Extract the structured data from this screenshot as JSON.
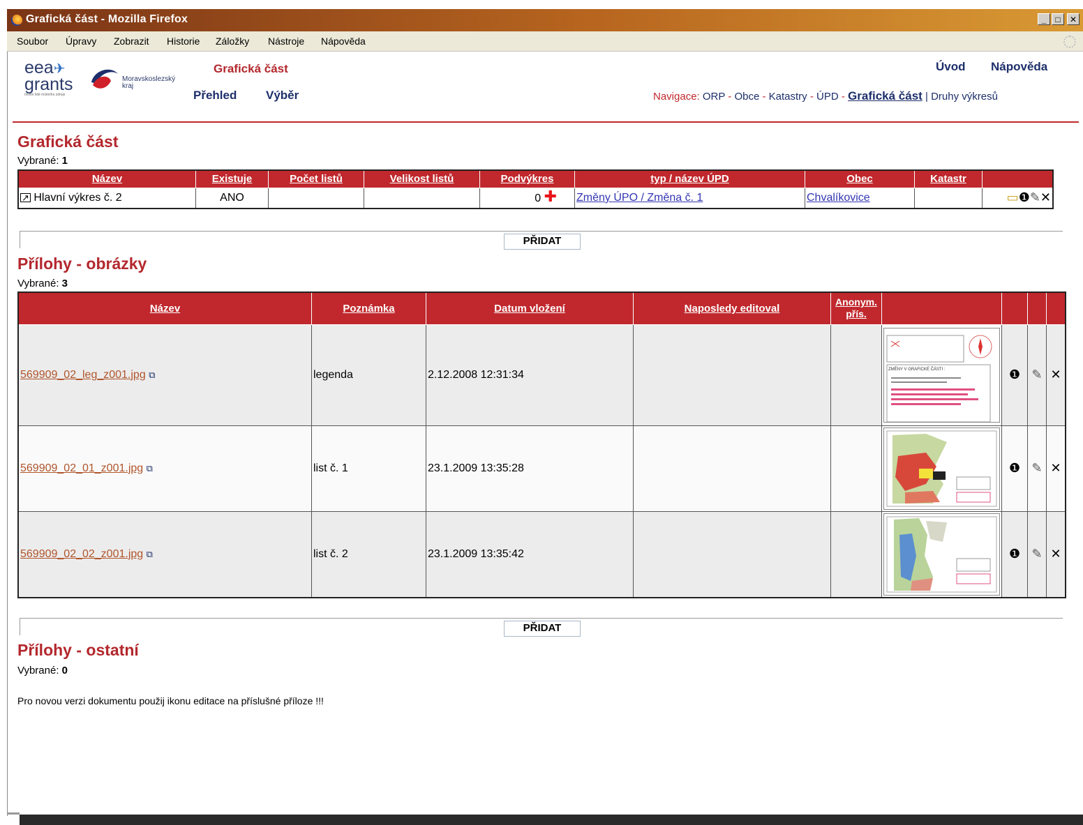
{
  "window": {
    "title": "Grafická část - Mozilla Firefox",
    "btn_min": "_",
    "btn_max": "□",
    "btn_close": "✕"
  },
  "menu": [
    "Soubor",
    "Úpravy",
    "Zobrazit",
    "Historie",
    "Záložky",
    "Nástroje",
    "Nápověda"
  ],
  "logos": {
    "eea_text": "eea",
    "eea_text2": "grants",
    "eea_sub": "místní lidé místního zdroje",
    "kraj_text": "Moravskoslezský",
    "kraj_text2": "kraj"
  },
  "header": {
    "section_title": "Grafická část",
    "prehled": "Přehled",
    "vyber": "Výběr",
    "uvod": "Úvod",
    "napoveda": "Nápověda",
    "nav_label": "Navigace:",
    "nav_orp": "ORP",
    "nav_obce": "Obce",
    "nav_katastry": "Katastry",
    "nav_upd": "ÚPD",
    "nav_graficka": "Grafická část",
    "nav_druhy": "Druhy výkresů",
    "sep_dash": " - ",
    "sep_bar": " | "
  },
  "graficka": {
    "title": "Grafická část",
    "selected_label": "Vybrané:",
    "selected_count": "1",
    "columns": [
      "Název",
      "Existuje",
      "Počet listů",
      "Velikost listů",
      "Podvýkres",
      "typ / název ÚPD",
      "Obec",
      "Katastr"
    ],
    "row": {
      "nazev": "Hlavní výkres č. 2",
      "existuje": "ANO",
      "pocet": "",
      "velikost": "",
      "podvykres": "0",
      "upd": "Změny ÚPO / Změna č. 1",
      "obec": "Chvalíkovice",
      "katastr": ""
    }
  },
  "add_button": "PŘIDAT",
  "obrazky": {
    "title": "Přílohy - obrázky",
    "selected_label": "Vybrané:",
    "selected_count": "3",
    "columns": [
      "Název",
      "Poznámka",
      "Datum vložení",
      "Naposledy editoval",
      "Anonym.",
      "přís."
    ],
    "rows": [
      {
        "nazev": "569909_02_leg_z001.jpg",
        "poznamka": "legenda",
        "datum": "2.12.2008 12:31:34",
        "editoval": ""
      },
      {
        "nazev": "569909_02_01_z001.jpg",
        "poznamka": "list č. 1",
        "datum": "23.1.2009 13:35:28",
        "editoval": ""
      },
      {
        "nazev": "569909_02_02_z001.jpg",
        "poznamka": "list č. 2",
        "datum": "23.1.2009 13:35:42",
        "editoval": ""
      }
    ],
    "thumb0_title": "ZMĚNY V GRAFICKÉ ČÁSTI :"
  },
  "ostatni": {
    "title": "Přílohy - ostatní",
    "selected_label": "Vybrané:",
    "selected_count": "0",
    "note": "Pro novou verzi dokumentu použij ikonu editace na příslušné příloze !!!"
  },
  "colors": {
    "brand_red": "#c0282d",
    "nav_blue": "#1d2f6b",
    "link_purple": "#3436b2",
    "file_link": "#b0552c"
  }
}
